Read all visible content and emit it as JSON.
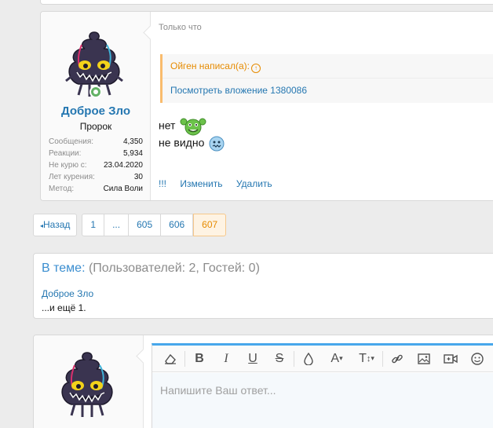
{
  "post": {
    "date": "Только что",
    "user": {
      "name": "Доброе Зло",
      "title": "Пророк",
      "stats": [
        {
          "label": "Сообщения:",
          "value": "4,350"
        },
        {
          "label": "Реакции:",
          "value": "5,934"
        },
        {
          "label": "Не курю с:",
          "value": "23.04.2020"
        },
        {
          "label": "Лет курения:",
          "value": "30"
        },
        {
          "label": "Метод:",
          "value": "Сила Воли"
        }
      ]
    },
    "quote": {
      "author": "Ойген написал(а):",
      "link": "Посмотреть вложение 1380086"
    },
    "message": {
      "line1": "нет",
      "line2": "не видно"
    },
    "actions": {
      "report": "!!!",
      "edit": "Изменить",
      "delete": "Удалить"
    }
  },
  "pagination": {
    "back": "Назад",
    "pages": [
      "1",
      "...",
      "605",
      "606",
      "607"
    ],
    "current": "607"
  },
  "in_thread": {
    "title": "В теме:",
    "counts": "(Пользователей: 2, Гостей: 0)",
    "user": "Доброе Зло",
    "more": "...и ещё 1."
  },
  "reply": {
    "placeholder": "Напишите Ваш ответ...",
    "toolbar_icons": [
      "eraser-icon",
      "bold-icon",
      "italic-icon",
      "underline-icon",
      "strikethrough-icon",
      "color-icon",
      "font-icon",
      "text-size-icon",
      "link-icon",
      "image-icon",
      "media-icon",
      "smiley-icon"
    ]
  },
  "colors": {
    "link": "#2577b1",
    "accent": "#47a7eb",
    "quote_border": "#f9bc6d",
    "current_page_bg": "#fef3e3"
  }
}
